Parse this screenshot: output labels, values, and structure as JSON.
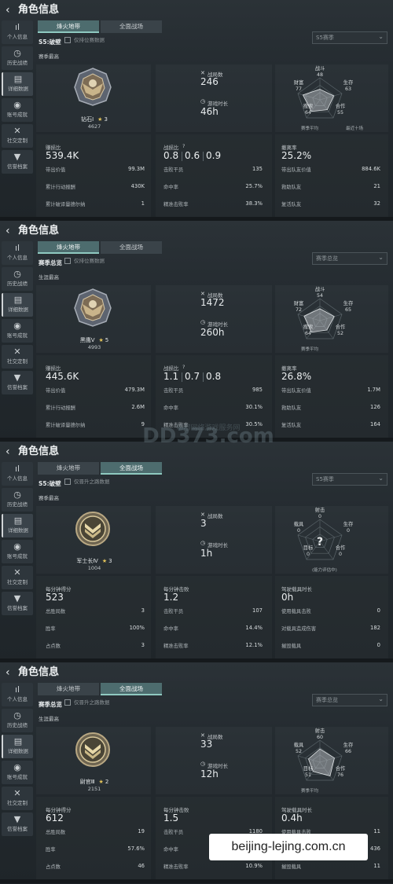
{
  "common": {
    "title": "角色信息",
    "tabs": [
      "烽火地带",
      "全面战场"
    ],
    "sidebar": [
      "个人信息",
      "历史战绩",
      "详细数据",
      "账号成就",
      "社交定制",
      "信誉档案"
    ],
    "kd_label": "战损比",
    "kd_help": "?",
    "games_label": "战局数",
    "time_label": "游戏时长",
    "legend_self": "赛季平均",
    "legend_top": "最近十场",
    "power_note": "(能力评估中)"
  },
  "panels": [
    {
      "selected_tab": 0,
      "season": "S5:破壁",
      "checkbox": "仅排位赛数据",
      "dropdown": "S5赛季",
      "subhead": "赛季最高",
      "rank_name": "钻石Ⅰ",
      "rank_stars": "3",
      "rank_points": "4627",
      "games": "246",
      "time": "46h",
      "radar_labels": [
        "战斗",
        "生存",
        "合作",
        "搜索",
        "财富"
      ],
      "radar_values": [
        "48",
        "63",
        "55",
        "64",
        "77"
      ],
      "legend": [
        "赛季平均",
        "最近十场"
      ],
      "col1_label": "赚损比",
      "col1_value": "539.4K",
      "kd": [
        "0.8",
        "0.6",
        "0.9"
      ],
      "col3_label": "撤离率",
      "col3_value": "25.2%",
      "rows": [
        [
          [
            "带出价值",
            "99.3M"
          ],
          [
            "击败干员",
            "135"
          ],
          [
            "带出队友价值",
            "884.6K"
          ]
        ],
        [
          [
            "累计行动报酬",
            "430K"
          ],
          [
            "命中率",
            "25.7%"
          ],
          [
            "救助队友",
            "21"
          ]
        ],
        [
          [
            "累计破译量德尔纳",
            "1"
          ],
          [
            "精准击败率",
            "38.3%"
          ],
          [
            "复活队友",
            "32"
          ]
        ]
      ]
    },
    {
      "selected_tab": 0,
      "season": "赛季总览",
      "checkbox": "仅排位赛数据",
      "dropdown": "赛季总览",
      "subhead": "生涯最高",
      "rank_name": "黑鹰Ⅴ",
      "rank_stars": "5",
      "rank_points": "4993",
      "games": "1472",
      "time": "260h",
      "radar_labels": [
        "战斗",
        "生存",
        "合作",
        "搜索",
        "财富"
      ],
      "radar_values": [
        "54",
        "65",
        "52",
        "64",
        "72"
      ],
      "legend": [
        "赛季平均",
        ""
      ],
      "col1_label": "赚损比",
      "col1_value": "445.6K",
      "kd": [
        "1.1",
        "0.7",
        "0.8"
      ],
      "col3_label": "撤离率",
      "col3_value": "26.8%",
      "rows": [
        [
          [
            "带出价值",
            "479.3M"
          ],
          [
            "击败干员",
            "985"
          ],
          [
            "带出队友价值",
            "1.7M"
          ]
        ],
        [
          [
            "累计行动报酬",
            "2.6M"
          ],
          [
            "命中率",
            "30.1%"
          ],
          [
            "救助队友",
            "126"
          ]
        ],
        [
          [
            "累计破译量德尔纳",
            "9"
          ],
          [
            "精准击败率",
            "30.5%"
          ],
          [
            "复活队友",
            "164"
          ]
        ]
      ]
    },
    {
      "selected_tab": 1,
      "season": "S5:破壁",
      "checkbox": "仅晋升之路数据",
      "dropdown": "S5赛季",
      "subhead": "赛季最高",
      "rank_name": "军士长Ⅳ",
      "rank_stars": "3",
      "rank_points": "1004",
      "games": "3",
      "time": "1h",
      "radar_labels": [
        "射击",
        "生存",
        "合作",
        "目标",
        "载具"
      ],
      "radar_values": [
        "0",
        "0",
        "0",
        "0",
        "0"
      ],
      "legend": [
        "",
        ""
      ],
      "col1_label": "每分钟得分",
      "col1_value": "523",
      "kd": [
        "1.2"
      ],
      "kd_label_override": "每分钟击败",
      "col3_label": "驾驶载具时长",
      "col3_value": "0h",
      "rows": [
        [
          [
            "总胜局数",
            "3"
          ],
          [
            "击败干员",
            "107"
          ],
          [
            "使用载具击败",
            "0"
          ]
        ],
        [
          [
            "胜率",
            "100%"
          ],
          [
            "命中率",
            "14.4%"
          ],
          [
            "对载具造成伤害",
            "182"
          ]
        ],
        [
          [
            "占点数",
            "3"
          ],
          [
            "精准击败率",
            "12.1%"
          ],
          [
            "摧毁载具",
            "0"
          ]
        ]
      ]
    },
    {
      "selected_tab": 1,
      "season": "赛季总览",
      "checkbox": "仅晋升之路数据",
      "dropdown": "赛季总览",
      "subhead": "生涯最高",
      "rank_name": "尉官Ⅲ",
      "rank_stars": "2",
      "rank_points": "2151",
      "games": "33",
      "time": "12h",
      "radar_labels": [
        "射击",
        "生存",
        "合作",
        "目标",
        "载具"
      ],
      "radar_values": [
        "60",
        "66",
        "76",
        "51",
        "52"
      ],
      "legend": [
        "赛季平均",
        ""
      ],
      "col1_label": "每分钟得分",
      "col1_value": "612",
      "kd": [
        "1.5"
      ],
      "kd_label_override": "每分钟击败",
      "col3_label": "驾驶载具时长",
      "col3_value": "0.4h",
      "rows": [
        [
          [
            "总胜局数",
            "19"
          ],
          [
            "击败干员",
            "1180"
          ],
          [
            "使用载具击败",
            "11"
          ]
        ],
        [
          [
            "胜率",
            "57.6%"
          ],
          [
            "命中率",
            ""
          ],
          [
            "对载具造成伤害",
            "436"
          ]
        ],
        [
          [
            "占点数",
            "46"
          ],
          [
            "精准击败率",
            "10.9%"
          ],
          [
            "摧毁载具",
            "11"
          ]
        ]
      ]
    }
  ],
  "watermark": {
    "main": "DD373.com",
    "sub": "嘟嘟网络游戏服务网"
  },
  "site_badge": "beijing-lejing.com.cn"
}
